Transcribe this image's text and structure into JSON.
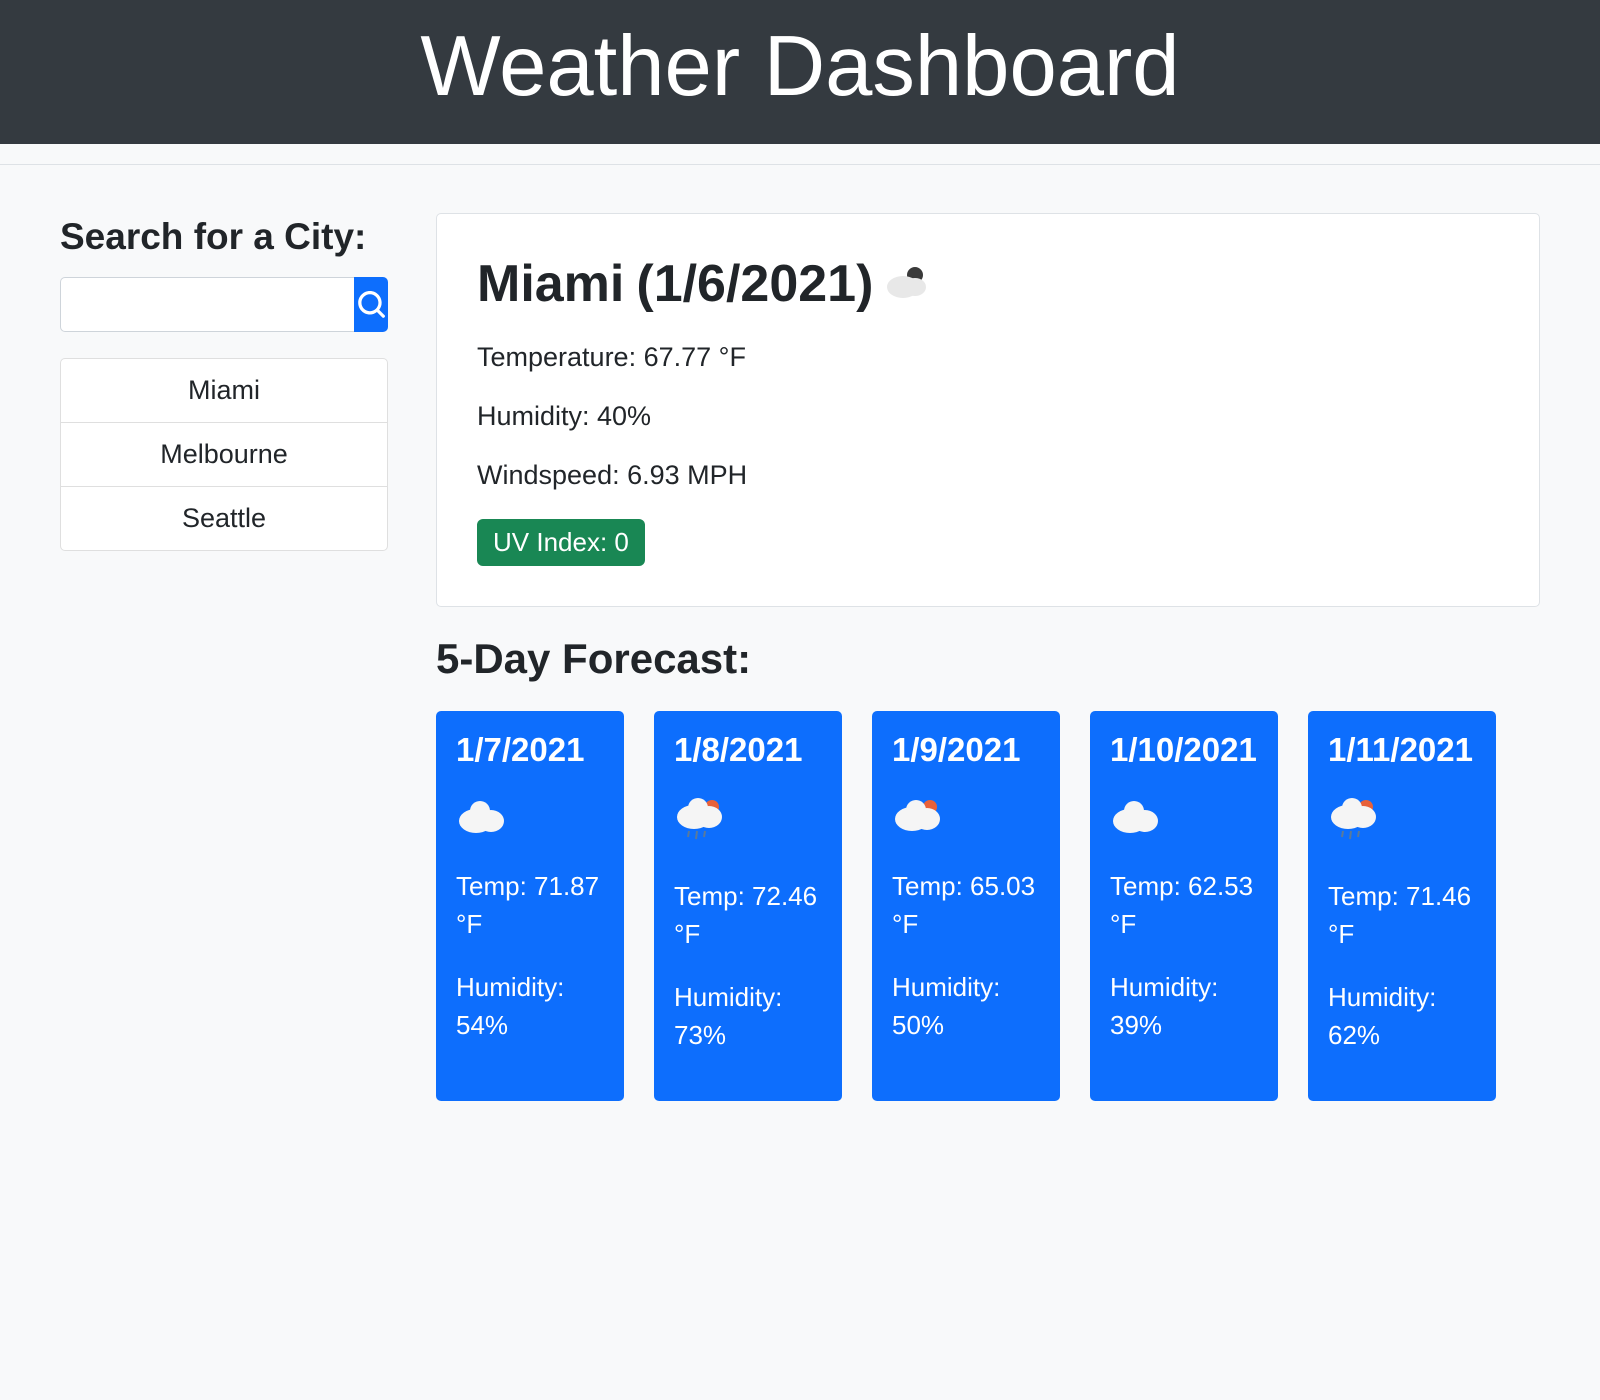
{
  "header": {
    "title": "Weather Dashboard"
  },
  "sidebar": {
    "search_label": "Search for a City:",
    "search_value": "",
    "cities": [
      "Miami",
      "Melbourne",
      "Seattle"
    ]
  },
  "current": {
    "city": "Miami",
    "date": "(1/6/2021)",
    "icon": "few-clouds",
    "temp_label": "Temperature: 67.77 °F",
    "humidity_label": "Humidity: 40%",
    "windspeed_label": "Windspeed: 6.93 MPH",
    "uv_label": "UV Index: 0",
    "uv_color": "#198754"
  },
  "forecast": {
    "heading": "5-Day Forecast:",
    "days": [
      {
        "date": "1/7/2021",
        "icon": "clouds",
        "temp": "Temp: 71.87 °F",
        "humidity": "Humidity: 54%"
      },
      {
        "date": "1/8/2021",
        "icon": "rain",
        "temp": "Temp: 72.46 °F",
        "humidity": "Humidity: 73%"
      },
      {
        "date": "1/9/2021",
        "icon": "sun-cloud",
        "temp": "Temp: 65.03 °F",
        "humidity": "Humidity: 50%"
      },
      {
        "date": "1/10/2021",
        "icon": "clouds",
        "temp": "Temp: 62.53 °F",
        "humidity": "Humidity: 39%"
      },
      {
        "date": "1/11/2021",
        "icon": "rain",
        "temp": "Temp: 71.46 °F",
        "humidity": "Humidity: 62%"
      }
    ]
  }
}
